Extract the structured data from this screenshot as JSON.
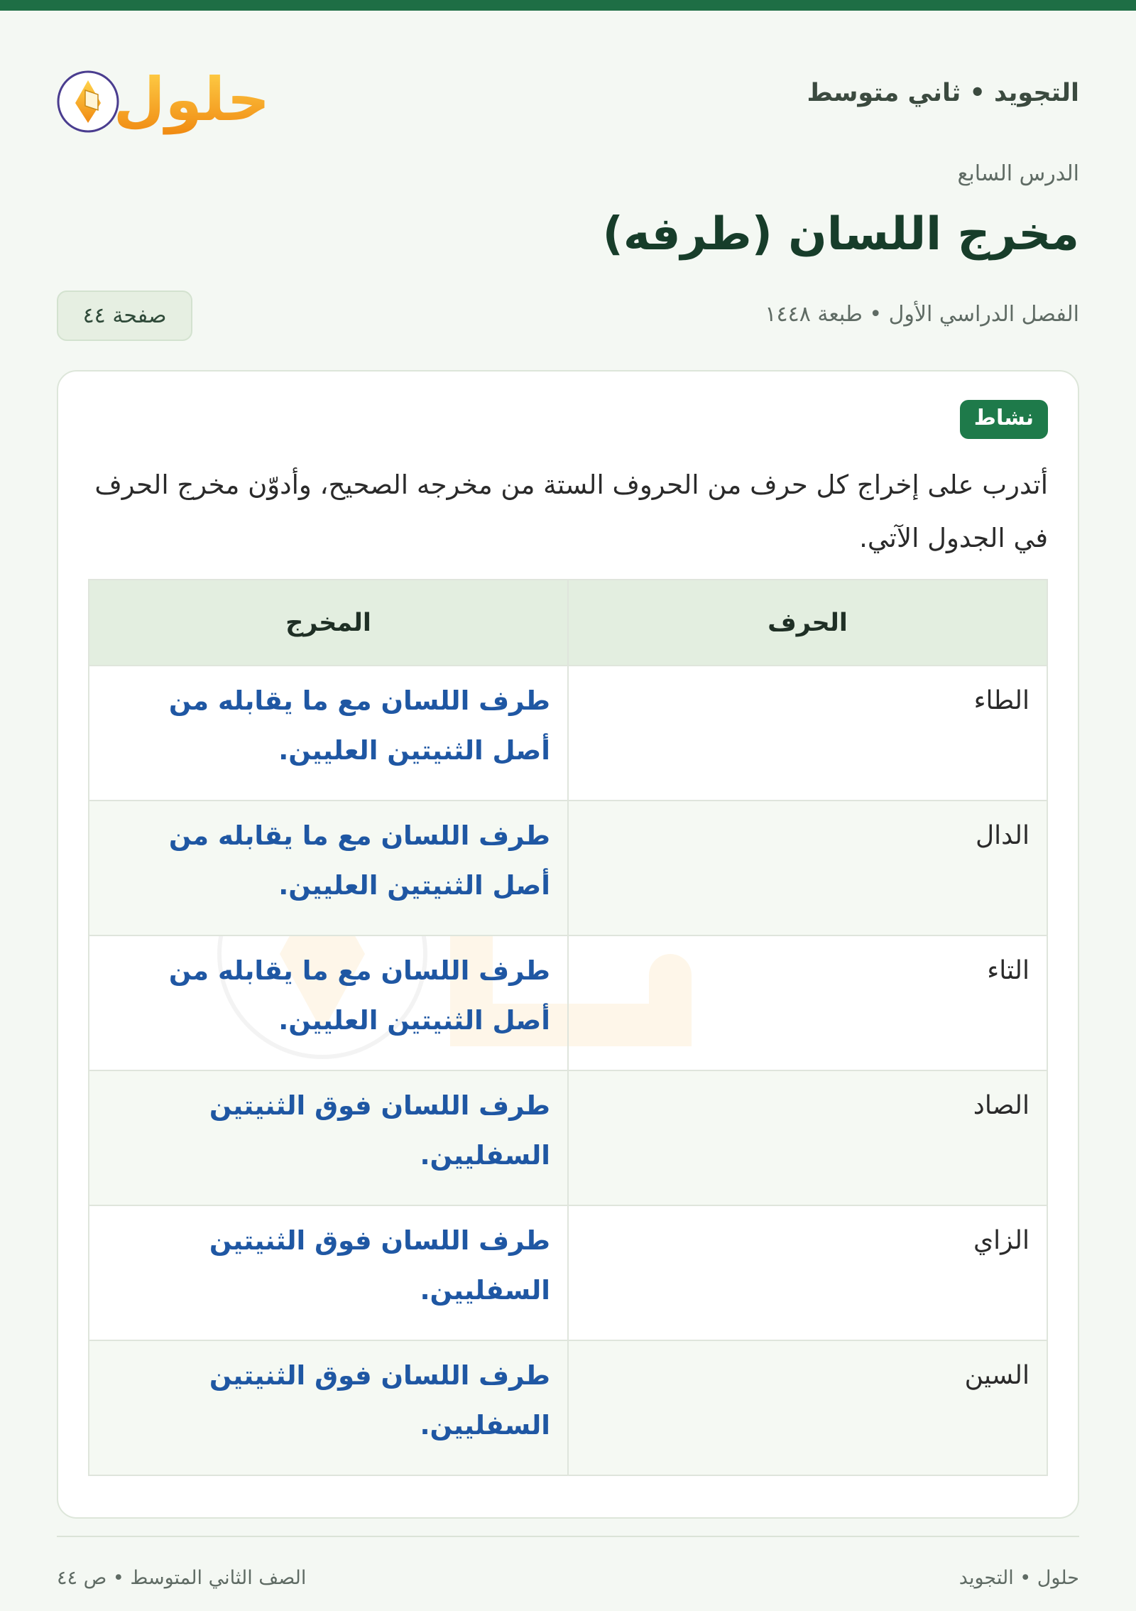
{
  "header": {
    "subject": "التجويد • ثاني متوسط",
    "logo_text": "حلول"
  },
  "lesson": {
    "label": "الدرس السابع",
    "title": "مخرج اللسان (طرفه)",
    "semester": "الفصل الدراسي الأول • طبعة ١٤٤٨",
    "page_chip": "صفحة ٤٤"
  },
  "activity": {
    "badge": "نشاط",
    "instruction": "أتدرب على إخراج كل حرف من الحروف الستة من مخرجه الصحيح، وأدوّن مخرج الحرف في الجدول الآتي.",
    "table": {
      "headers": [
        "الحرف",
        "المخرج"
      ],
      "rows": [
        {
          "letter": "الطاء",
          "outlet": "طرف اللسان مع ما يقابله من أصل الثنيتين العليين."
        },
        {
          "letter": "الدال",
          "outlet": "طرف اللسان مع ما يقابله من أصل الثنيتين العليين."
        },
        {
          "letter": "التاء",
          "outlet": "طرف اللسان مع ما يقابله من أصل الثنيتين العليين."
        },
        {
          "letter": "الصاد",
          "outlet": "طرف اللسان فوق الثنيتين السفليين."
        },
        {
          "letter": "الزاي",
          "outlet": "طرف اللسان فوق الثنيتين السفليين."
        },
        {
          "letter": "السين",
          "outlet": "طرف اللسان فوق الثنيتين السفليين."
        }
      ]
    }
  },
  "footer": {
    "right": "حلول • التجويد",
    "left": "الصف الثاني المتوسط • ص ٤٤"
  },
  "colors": {
    "brand_green": "#1e6e45",
    "answer_blue": "#1f57a3",
    "logo_orange": "#f5a81c"
  }
}
